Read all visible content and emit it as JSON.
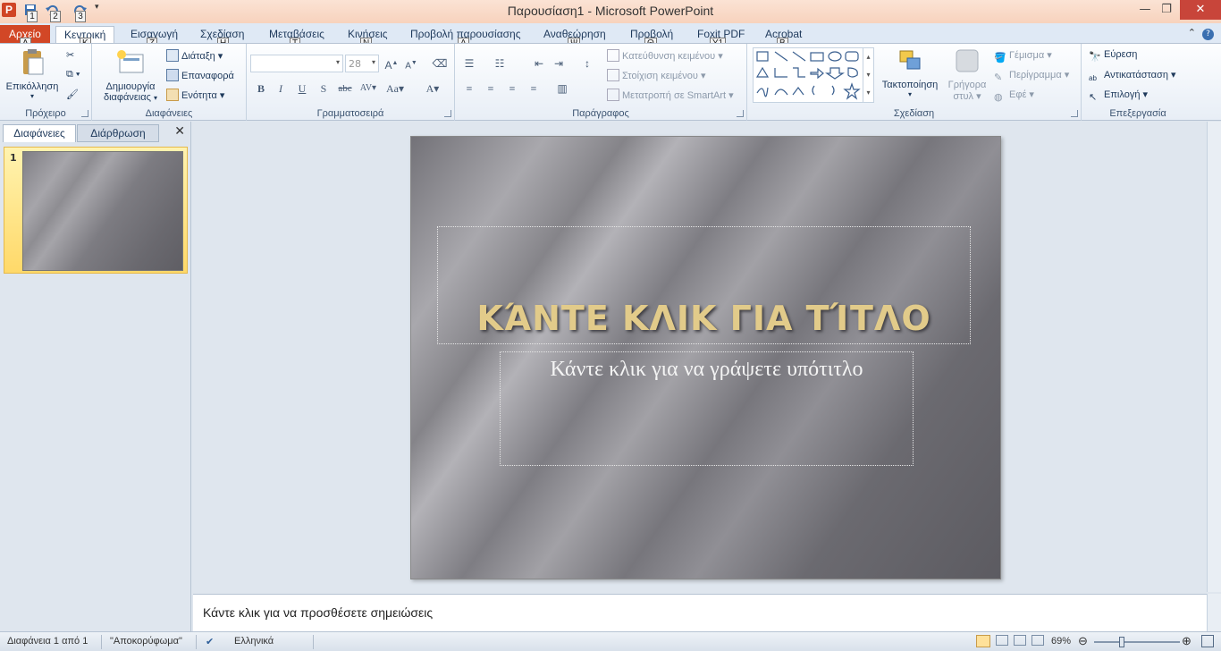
{
  "window": {
    "title": "Παρουσίαση1  -  Microsoft PowerPoint",
    "qat_keytips": [
      "1",
      "2",
      "3"
    ],
    "minimize": "—",
    "restore": "❐",
    "close": "✕"
  },
  "tabs": [
    {
      "label": "Αρχείο",
      "keytip": "A"
    },
    {
      "label": "Κεντρική",
      "keytip": "K"
    },
    {
      "label": "Εισαγωγή",
      "keytip": "Z"
    },
    {
      "label": "Σχεδίαση",
      "keytip": "H"
    },
    {
      "label": "Μεταβάσεις",
      "keytip": "T"
    },
    {
      "label": "Κινήσεις",
      "keytip": "N"
    },
    {
      "label": "Προβολή παρουσίασης",
      "keytip": "Δ"
    },
    {
      "label": "Αναθεώρηση",
      "keytip": "Ψ"
    },
    {
      "label": "Προβολή",
      "keytip": "Θ"
    },
    {
      "label": "Foxit PDF",
      "keytip": "Y1"
    },
    {
      "label": "Acrobat",
      "keytip": "B"
    }
  ],
  "ribbon": {
    "clipboard": {
      "label": "Πρόχειρο",
      "paste": "Επικόλληση"
    },
    "slides": {
      "label": "Διαφάνειες",
      "new_slide_line1": "Δημιουργία",
      "new_slide_line2": "διαφάνειας",
      "layout": "Διάταξη",
      "reset": "Επαναφορά",
      "section": "Ενότητα"
    },
    "font": {
      "label": "Γραμματοσειρά",
      "size": "28"
    },
    "paragraph": {
      "label": "Παράγραφος",
      "text_direction": "Κατεύθυνση κειμένου",
      "align_text": "Στοίχιση κειμένου",
      "smartart": "Μετατροπή σε SmartArt"
    },
    "drawing": {
      "label": "Σχεδίαση",
      "arrange": "Τακτοποίηση",
      "quick_styles_line1": "Γρήγορα",
      "quick_styles_line2": "στυλ",
      "fill": "Γέμισμα",
      "outline": "Περίγραμμα",
      "effects": "Εφέ"
    },
    "editing": {
      "label": "Επεξεργασία",
      "find": "Εύρεση",
      "replace": "Αντικατάσταση",
      "select": "Επιλογή"
    }
  },
  "leftpane": {
    "tab_slides": "Διαφάνειες",
    "tab_outline": "Διάρθρωση",
    "close": "✕",
    "slide_number": "1"
  },
  "slide": {
    "title": "ΚΆΝΤΕ ΚΛΙΚ ΓΙΑ ΤΊΤΛΟ",
    "subtitle": "Κάντε κλικ για να γράψετε υπότιτλο"
  },
  "notes": {
    "text": "Κάντε κλικ για να προσθέσετε σημειώσεις"
  },
  "status": {
    "slide_count": "Διαφάνεια 1 από 1",
    "theme": "\"Αποκορύφωμα\"",
    "language": "Ελληνικά",
    "zoom": "69%"
  },
  "colors": {
    "file_tab": "#d24726",
    "title_text": "#e2cb8a",
    "selection": "#ffd969"
  }
}
